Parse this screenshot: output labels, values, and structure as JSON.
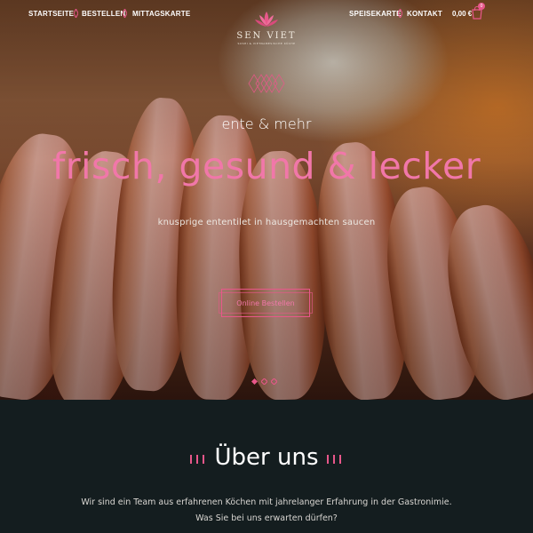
{
  "nav": {
    "left": [
      {
        "label": "STARTSEITE"
      },
      {
        "label": "BESTELLEN"
      },
      {
        "label": "MITTAGSKARTE"
      }
    ],
    "right": [
      {
        "label": "SPEISEKARTE"
      },
      {
        "label": "KONTAKT"
      }
    ],
    "cart": {
      "total": "0,00 €",
      "count": "0",
      "icon": "shopping-bag-icon"
    }
  },
  "logo": {
    "name": "SEN VIET",
    "tagline": "SUSHI & VIETNAMESISCHE KÜCHE",
    "icon": "lotus-icon"
  },
  "hero": {
    "kicker": "ente & mehr",
    "headline": "frisch, gesund & lecker",
    "subline": "knusprige ententilet in hausgemachten saucen",
    "cta_label": "Online Bestellen",
    "active_slide": 1,
    "slide_count": 3
  },
  "about": {
    "title": "Über uns",
    "text": "Wir sind ein Team aus erfahrenen Köchen mit jahrelanger Erfahrung in der Gastronimie. Was Sie bei uns erwarten dürfen?"
  },
  "colors": {
    "accent": "#e8578a",
    "headline": "#f177a9",
    "background": "#141d1f"
  }
}
